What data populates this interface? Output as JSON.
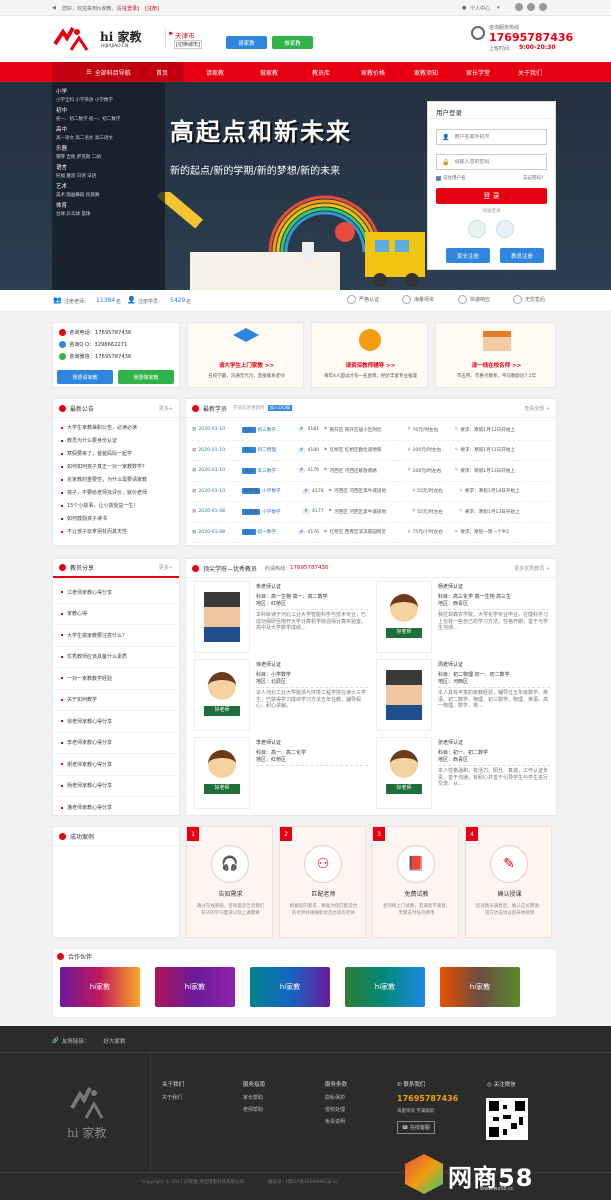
{
  "topbar": {
    "welcome": "您好，欢迎来到hi家教，请先",
    "login": "[登录]",
    "register": "[注册]",
    "user_center": "个人中心"
  },
  "header": {
    "logo_text": "hi 家教",
    "logo_sub": "HIJIAJIAO.CN",
    "city": "天津市",
    "city_switch": "[切换城市]",
    "btn_request": "请家教",
    "btn_be_tutor": "做家教",
    "hotline_label": "咨询服务热线",
    "hotline": "17695787436",
    "hours_label": "上班时间：",
    "hours": "9:00-20:30"
  },
  "nav": {
    "all": "全部科目导航",
    "items": [
      "首页",
      "请家教",
      "做家教",
      "教员库",
      "家教价格",
      "家教须知",
      "家长学堂",
      "关于我们"
    ]
  },
  "banner": {
    "title": "高起点和新未来",
    "subtitle": "新的起点/新的学期/新的梦想/新的未来"
  },
  "menu": [
    {
      "cat": "小学",
      "subs": "小学全科 小学英语 小学数学"
    },
    {
      "cat": "初中",
      "subs": "初一、初二数学 初一、初二数学"
    },
    {
      "cat": "高中",
      "subs": "高一语文 高二语文 高三语文"
    },
    {
      "cat": "乐器",
      "subs": "钢琴 吉他 萨克斯 二胡"
    },
    {
      "cat": "语言",
      "subs": "托福 雅思 日语 法语"
    },
    {
      "cat": "艺术",
      "subs": "美术 图画舞蹈 民族舞"
    },
    {
      "cat": "体育",
      "subs": "台球 乒乓球 篮球"
    }
  ],
  "login": {
    "title": "用户登录",
    "phone_ph": "用户名或手机号",
    "pwd_ph": "请输入您的密码",
    "remember": "记住用户名",
    "forgot": "忘记密码?",
    "submit": "登 录",
    "quick": "快速登录",
    "parent_reg": "家长注册",
    "tutor_reg": "教员注册"
  },
  "stats": {
    "tutors_label": "注册老师：",
    "tutors": "11384",
    "tutors_unit": "名",
    "students_label": "注册学员：",
    "students": "5429",
    "students_unit": "名",
    "features": [
      "严格认证",
      "海量师资",
      "快速响应",
      "无忧售后"
    ]
  },
  "contact": {
    "phone_label": "咨询电话：",
    "phone": "17695787436",
    "qq_label": "咨询Q Q：",
    "qq": "3298662271",
    "wx_label": "咨询微信：",
    "wx": "17695787436",
    "btn_req": "我想请家教",
    "btn_tutor": "我想做家教"
  },
  "promos": [
    {
      "title": "请大学生上门家教 >>",
      "desc": "名校学霸，沟通无代沟，直接联系老师"
    },
    {
      "title": "请资深教师辅导 >>",
      "desc": "每年4人面试才有一名金牌，经验丰富专业强理"
    },
    {
      "title": "请一线在校名师 >>",
      "desc": "市五所、市重点教师，平均教龄达7.5年"
    }
  ],
  "notice": {
    "title": "最新公告",
    "more": "更多+",
    "items": [
      "大学生家教兼职公告，必读必读",
      "教员为什么要身份认证",
      "寒假要来了，爸爸妈妈一起学",
      "如何如何孩子真正一对一家教数学?",
      "论家教的重要性，为什么需要请家教",
      "孩子，不要给老师找评价，就价老师",
      "15个小故事，让小孩受益一生!",
      "如何鼓励孩子读书",
      "不让孩子玩拿拐杖而其天性"
    ]
  },
  "students": {
    "title": "最新学员",
    "sub": "学员信息更新时",
    "qq_btn": "加入QQ群",
    "more": "查看全部 +",
    "rows": [
      {
        "date": "2020-01-10",
        "grade": "初三",
        "subj": "初三数学...",
        "id": "4181",
        "area": "南开区 南开区居小区附近",
        "price": "70元/时左右",
        "req": "要求：寒假1月12日开始上"
      },
      {
        "date": "2020-01-10",
        "grade": "初二",
        "subj": "初二物理",
        "id": "4180",
        "area": "红桥区 红桥区勤俭道地铁",
        "price": "100元/时左右",
        "req": "要求：寒假1月11日开始上"
      },
      {
        "date": "2020-01-10",
        "grade": "高三",
        "subj": "高三数学",
        "id": "4179",
        "area": "河西区 河西区解放南路",
        "price": "100元/时左右",
        "req": "要求：寒假1月13日开始上"
      },
      {
        "date": "2020-01-10",
        "grade": "四年级",
        "subj": "小学数学",
        "id": "4178",
        "area": "河西区 河西区黑牛城道地",
        "price": "55元/时左右",
        "req": "要求：寒假1月18日开始上"
      },
      {
        "date": "2020-01-08",
        "grade": "五年级",
        "subj": "小学数学",
        "id": "4177",
        "area": "河西区 河西区黑牛城道地",
        "price": "55元/时左右",
        "req": "要求：寒假1月13日开始上"
      },
      {
        "date": "2020-01-08",
        "grade": "初一",
        "subj": "初一数学",
        "id": "4176",
        "area": "红桥区 西青区滨滨家园附近",
        "price": "75元/小时左右",
        "req": "要求：寒假一周一个半2"
      }
    ]
  },
  "share": {
    "title": "教员分享",
    "more": "更多+",
    "items": [
      "江老师家教心得分享",
      "家教心得",
      "大学生做家教要注意什么?",
      "优秀教师应该具备什么素质",
      "一对一家教教学经验",
      "关于如何教学",
      "徐老师家教心得分享",
      "李老师家教心得分享",
      "谢老师家教心得分享",
      "杨老师家教心得分享",
      "潘老师家教心得分享"
    ]
  },
  "teachers": {
    "title": "顶尖学府—优秀教员",
    "hotline_label": "约请热线：",
    "hotline": "17695787436",
    "more": "更多优秀教员 +",
    "cert": "认证",
    "list": [
      {
        "name": "朱老师",
        "subj": "科目：高一生物 高一、高二数学",
        "area": "地区：红桥区",
        "bio": "本科就读于河北工业大学智能科学与技术专业，已成功保研至南开大学计算机学院强保计算实验室。高中及大学数学成绩..."
      },
      {
        "name": "杨老师",
        "subj": "科目：高三化学 高一生物 高三生",
        "area": "地区：西青区",
        "bio": "我拉却森农学院，大学化学专业毕业，在理科学习上也有一些自己的学习方法，性格开朗，善于与学生沟通..."
      },
      {
        "name": "徐老师",
        "subj": "科目：小学数学",
        "area": "地区：北辰区",
        "bio": "本人河北工业大学能源与环境工程学院在读大三学生，已获得学习成绩学习方法五年任教，辅导假心、耐心讲解。"
      },
      {
        "name": "周老师",
        "subj": "科目：初二物理 初一、初二数学",
        "area": "地区：河西区",
        "bio": "本人具有丰富的家教经验，辅导过五年级数学、英语、初二数学、物理、初三数学、物理、英语、高一物理、数学、英..."
      },
      {
        "name": "李老师",
        "subj": "科目：高一、高二化学",
        "area": "地区：红桥区",
        "bio": ""
      },
      {
        "name": "张老师",
        "subj": "科目：初一、初二数学",
        "area": "地区：西青区",
        "bio": "本人性格温和，有活力。阳光、真诚，工作认证负责，善于沟通，有耐心并善于引导学生与学生进行交流，从..."
      }
    ]
  },
  "success": {
    "title": "成功案例"
  },
  "steps": [
    {
      "n": "1",
      "title": "告知需求",
      "desc": "通过在线客服、咨询电话告诉我们孩子的学习需求以及上课需要"
    },
    {
      "n": "2",
      "title": "匹配老师",
      "desc": "根据您的需求，精准为您匹配适合的老师并确保能优选合适的老师"
    },
    {
      "n": "3",
      "title": "免费试教",
      "desc": "老师将上门试教，若满意不满意，无需支付任何费用"
    },
    {
      "n": "4",
      "title": "确认授课",
      "desc": "您对教员满意后，确认正式聘请，双方达成协议后开始授课"
    }
  ],
  "partners": {
    "title": "合作伙伴",
    "logo": "hi家教"
  },
  "footer": {
    "links_label": "友情链接：",
    "links": [
      "好大家教"
    ],
    "logo": "hi 家教",
    "cols": [
      {
        "title": "关于我们",
        "items": [
          "关于我们"
        ]
      },
      {
        "title": "服务指南",
        "items": [
          "家长帮助",
          "老师帮助"
        ]
      },
      {
        "title": "服务条款",
        "items": [
          "隐私保护",
          "侵权处理",
          "免责说明"
        ]
      }
    ],
    "contact_title": "联系我们",
    "phone": "17695787436",
    "svc": "海量师资 专属跟踪",
    "online": "在线客服",
    "wx_title": "关注微信",
    "copy": "Copyright © 2017 好家教 湖北博家科技有限公司",
    "icp": "备案号：[鄂ICP备16009081号-1]",
    "watermark": "网商58",
    "watermark_url": "www.ws58.cc"
  }
}
